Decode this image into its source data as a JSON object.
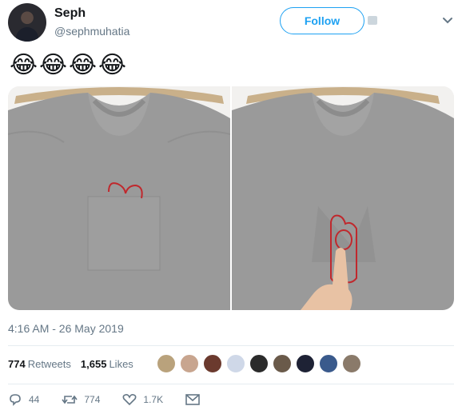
{
  "user": {
    "name": "Seph",
    "handle": "@sephmuhatia"
  },
  "follow_label": "Follow",
  "tweet": {
    "emoji": [
      "😂",
      "😂",
      "😂",
      "😂"
    ]
  },
  "timestamp": "4:16 AM - 26 May 2019",
  "stats": {
    "retweets_count": "774",
    "retweets_label": "Retweets",
    "likes_count": "1,655",
    "likes_label": "Likes"
  },
  "likers": [
    "#b9a27c",
    "#c8a58f",
    "#6b3a2e",
    "#cfd8e8",
    "#2b2b2b",
    "#6a5a4a",
    "#1e2235",
    "#3a5a8c",
    "#8a7a6a"
  ],
  "actions": {
    "reply_count": "44",
    "retweet_count": "774",
    "like_count": "1.7K"
  },
  "colors": {
    "accent": "#1da1f2",
    "muted": "#657786",
    "heart_red": "#c0282d"
  }
}
